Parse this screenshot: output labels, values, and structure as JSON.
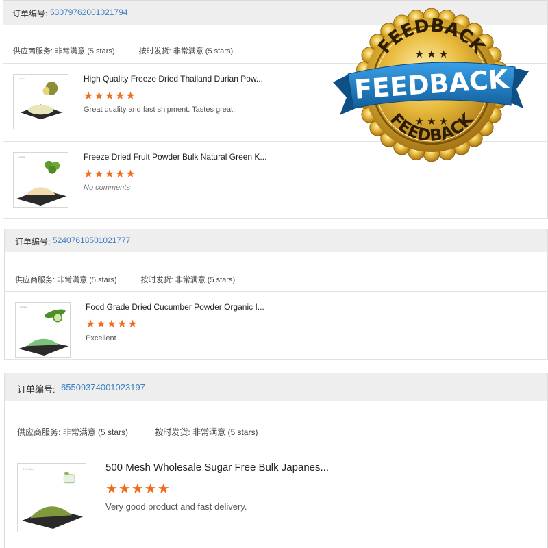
{
  "orders": [
    {
      "order_label": "订单编号:",
      "order_number": "53079762001021794",
      "supplier_service_label": "供应商服务:",
      "supplier_service_value": "非常满意",
      "supplier_service_stars": "(5 stars)",
      "shipping_label": "按时发货:",
      "shipping_value": "非常满意",
      "shipping_stars": "(5 stars)",
      "products": [
        {
          "title": "High Quality Freeze Dried Thailand Durian Pow...",
          "stars": "★★★★★",
          "rating": 5,
          "comment": "Great quality and fast shipment. Tastes great.",
          "powder_color": "#e8e6b8",
          "fruit_color": "#8b8f35"
        },
        {
          "title": "Freeze Dried Fruit Powder Bulk Natural Green K...",
          "stars": "★★★★★",
          "rating": 5,
          "comment": "No comments",
          "powder_color": "#f0dcae",
          "fruit_color": "#5e9a2c"
        }
      ]
    },
    {
      "order_label": "订单编号:",
      "order_number": "52407618501021777",
      "supplier_service_label": "供应商服务:",
      "supplier_service_value": "非常满意",
      "supplier_service_stars": "(5 stars)",
      "shipping_label": "按时发货:",
      "shipping_value": "非常满意",
      "shipping_stars": "(5 stars)",
      "products": [
        {
          "title": "Food Grade Dried Cucumber Powder Organic I...",
          "stars": "★★★★★",
          "rating": 5,
          "comment": "Excellent",
          "powder_color": "#7cc27a",
          "fruit_color": "#4f8f2a"
        }
      ]
    },
    {
      "order_label": "订单编号:",
      "order_number": "65509374001023197",
      "supplier_service_label": "供应商服务:",
      "supplier_service_value": "非常满意",
      "supplier_service_stars": "(5 stars)",
      "shipping_label": "按时发货:",
      "shipping_value": "非常满意",
      "shipping_stars": "(5 stars)",
      "products": [
        {
          "title": "500 Mesh Wholesale Sugar Free Bulk Japanes...",
          "stars": "★★★★★",
          "rating": 5,
          "comment": "Very good product and fast delivery.",
          "powder_color": "#7e9a3c",
          "fruit_color": "#8db84a"
        }
      ]
    }
  ],
  "badge": {
    "top_text": "FEEDBACK",
    "ribbon_text": "FEEDBACK",
    "bottom_text": "FEEDBACK",
    "stars": "★ ★ ★"
  },
  "colors": {
    "order_number": "#3d7fc1",
    "star": "#f26b1d",
    "header_bg": "#eeeeee",
    "gold": "#d9a627",
    "ribbon": "#1f7fc7"
  }
}
